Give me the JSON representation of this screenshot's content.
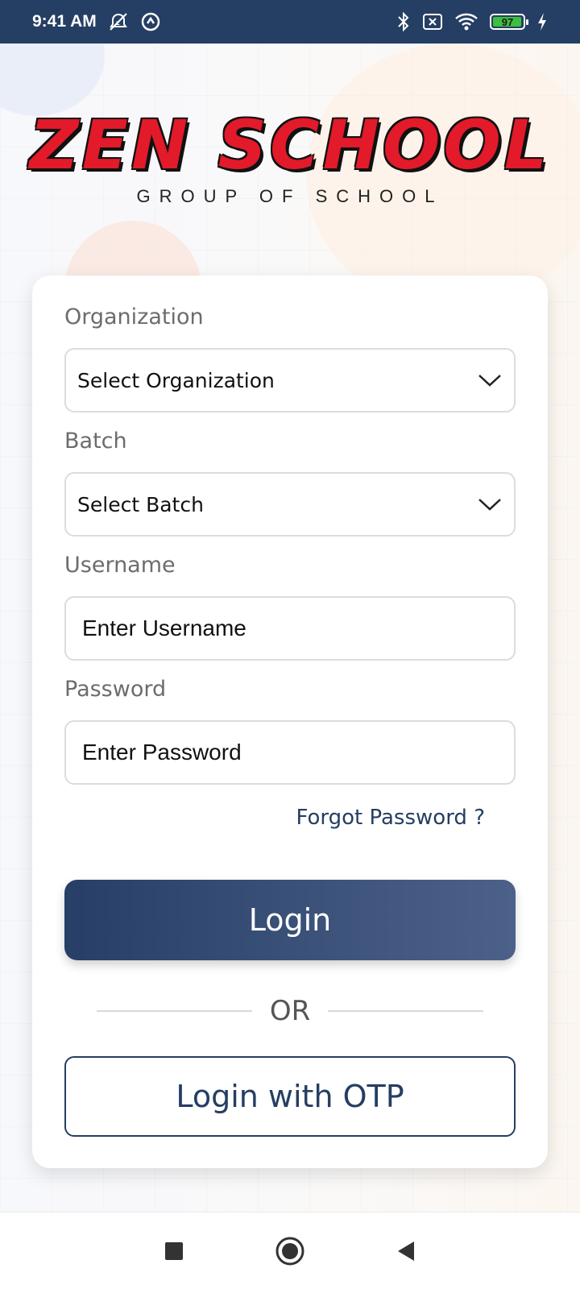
{
  "status_bar": {
    "time": "9:41 AM",
    "battery": "97"
  },
  "logo": {
    "title": "ZEN SCHOOL",
    "subtitle": "GROUP OF SCHOOL"
  },
  "form": {
    "organization_label": "Organization",
    "organization_value": "Select Organization",
    "batch_label": "Batch",
    "batch_value": "Select Batch",
    "username_label": "Username",
    "username_placeholder": "Enter Username",
    "password_label": "Password",
    "password_placeholder": "Enter Password",
    "forgot_password": "Forgot Password ?",
    "login_button": "Login",
    "or_text": "OR",
    "otp_button": "Login with OTP"
  },
  "colors": {
    "primary": "#253e63",
    "logo_red": "#e21a2a"
  },
  "icons": {
    "status": [
      "dnd-bell-off-icon",
      "sync-icon",
      "bluetooth-icon",
      "no-sim-icon",
      "wifi-icon",
      "battery-icon",
      "charging-icon"
    ],
    "nav": [
      "recents-square-icon",
      "home-circle-icon",
      "back-triangle-icon"
    ],
    "dropdown": "chevron-down-icon"
  }
}
